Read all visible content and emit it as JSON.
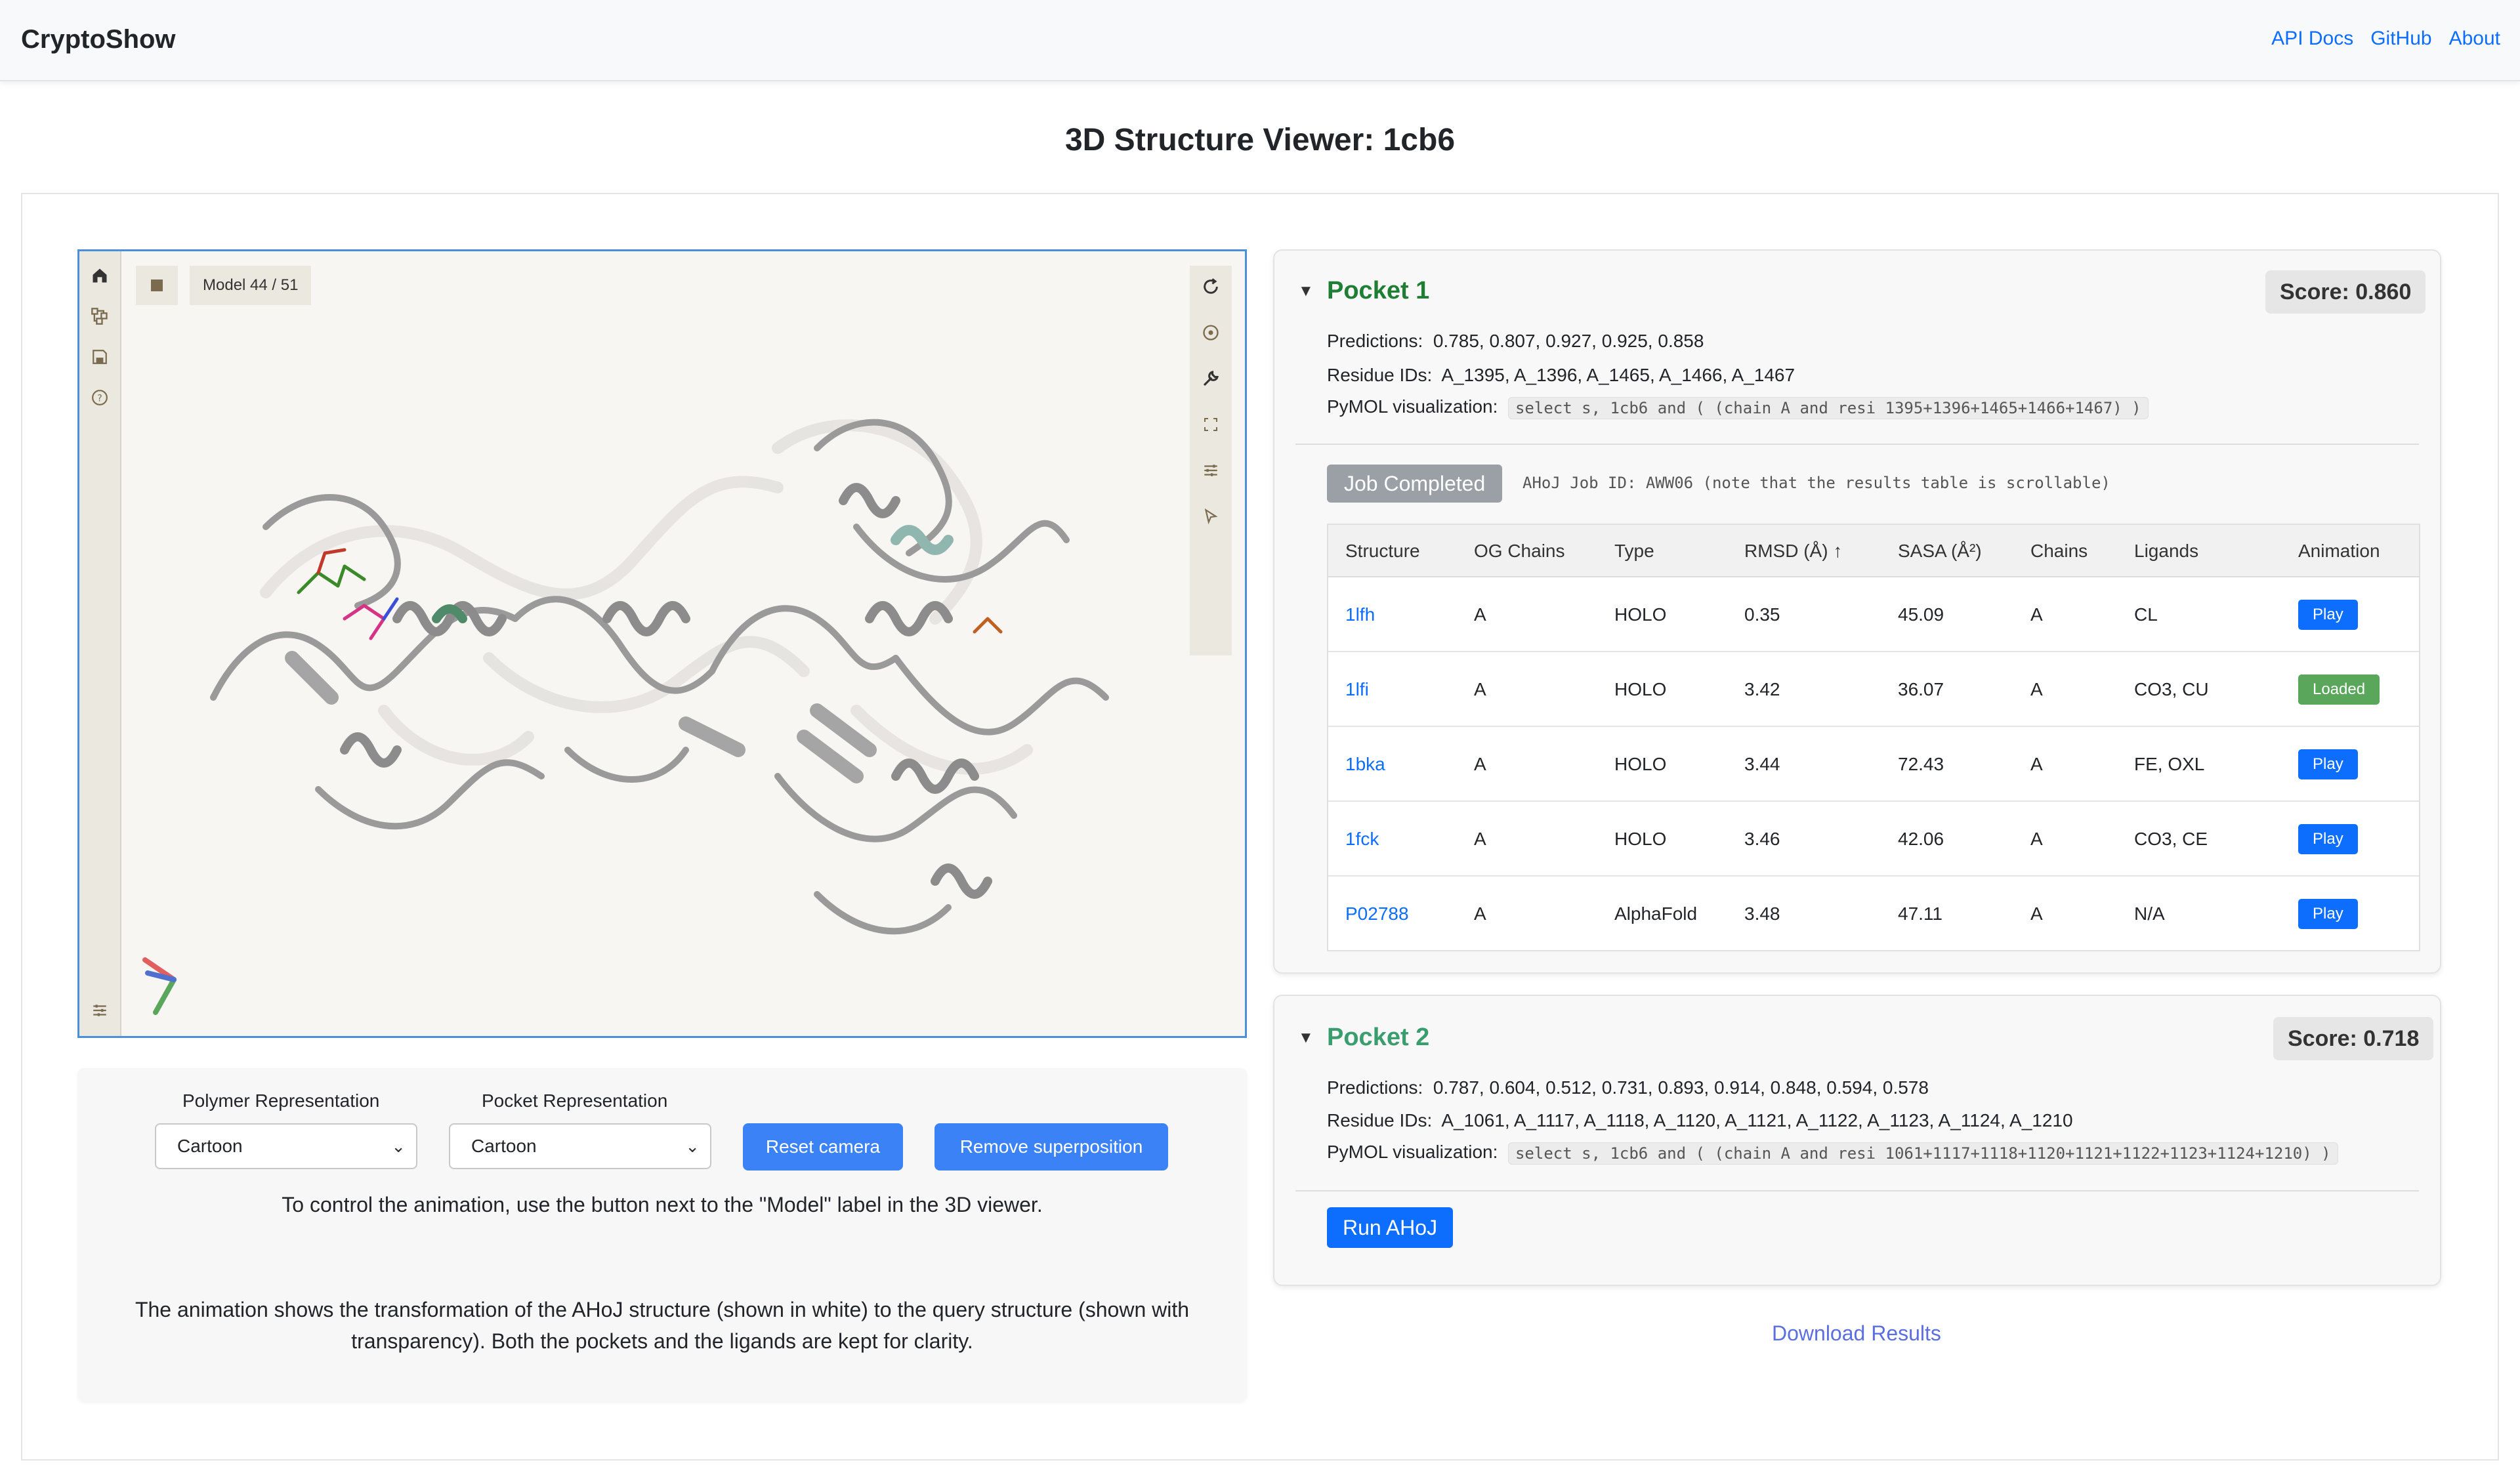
{
  "navbar": {
    "brand": "CryptoShow",
    "links": [
      "API Docs",
      "GitHub",
      "About"
    ]
  },
  "page": {
    "title": "3D Structure Viewer: 1cb6"
  },
  "viewer": {
    "model_label": "Model 44 / 51",
    "left_tools": [
      "home-icon",
      "structure-tree-icon",
      "save-icon",
      "help-icon",
      "settings-icon"
    ],
    "right_tools": [
      "rotate-icon",
      "spin-icon",
      "wrench-icon",
      "fullscreen-icon",
      "sliders-icon",
      "pointer-icon"
    ]
  },
  "controls": {
    "polymer_label": "Polymer Representation",
    "polymer_value": "Cartoon",
    "pocket_label": "Pocket Representation",
    "pocket_value": "Cartoon",
    "reset_camera": "Reset camera",
    "remove_superposition": "Remove superposition",
    "hint": "To control the animation, use the button next to the \"Model\" label in the 3D viewer.",
    "description_line1": "The animation shows the transformation of the AHoJ structure (shown in white) to the query structure (shown with",
    "description_line2": "transparency). Both the pockets and the ligands are kept for clarity."
  },
  "pocket1": {
    "title": "Pocket 1",
    "score": "Score: 0.860",
    "title_color": "#1e7e34",
    "predictions_label": "Predictions:",
    "predictions": "0.785, 0.807, 0.927, 0.925, 0.858",
    "residues_label": "Residue IDs:",
    "residues": "A_1395, A_1396, A_1465, A_1466, A_1467",
    "pymol_label": "PyMOL visualization:",
    "pymol": "select s, 1cb6 and ( (chain A and resi 1395+1396+1465+1466+1467) )",
    "job_status": "Job Completed",
    "job_info": "AHoJ Job ID: AWW06  (note that the results table is scrollable)",
    "table": {
      "headers": [
        "Structure",
        "OG Chains",
        "Type",
        "RMSD (Å) ↑",
        "SASA (Å²)",
        "Chains",
        "Ligands",
        "Animation"
      ],
      "rows": [
        {
          "structure": "1lfh",
          "og": "A",
          "type": "HOLO",
          "rmsd": "0.35",
          "sasa": "45.09",
          "chains": "A",
          "ligands": "CL",
          "anim": "Play"
        },
        {
          "structure": "1lfi",
          "og": "A",
          "type": "HOLO",
          "rmsd": "3.42",
          "sasa": "36.07",
          "chains": "A",
          "ligands": "CO3, CU",
          "anim": "Loaded"
        },
        {
          "structure": "1bka",
          "og": "A",
          "type": "HOLO",
          "rmsd": "3.44",
          "sasa": "72.43",
          "chains": "A",
          "ligands": "FE, OXL",
          "anim": "Play"
        },
        {
          "structure": "1fck",
          "og": "A",
          "type": "HOLO",
          "rmsd": "3.46",
          "sasa": "42.06",
          "chains": "A",
          "ligands": "CO3, CE",
          "anim": "Play"
        },
        {
          "structure": "P02788",
          "og": "A",
          "type": "AlphaFold",
          "rmsd": "3.48",
          "sasa": "47.11",
          "chains": "A",
          "ligands": "N/A",
          "anim": "Play"
        }
      ]
    }
  },
  "pocket2": {
    "title": "Pocket 2",
    "score": "Score: 0.718",
    "title_color": "#3a9d6e",
    "predictions_label": "Predictions:",
    "predictions": "0.787, 0.604, 0.512, 0.731, 0.893, 0.914, 0.848, 0.594, 0.578",
    "residues_label": "Residue IDs:",
    "residues": "A_1061, A_1117, A_1118, A_1120, A_1121, A_1122, A_1123, A_1124, A_1210",
    "pymol_label": "PyMOL visualization:",
    "pymol": "select s, 1cb6 and ( (chain A and resi 1061+1117+1118+1120+1121+1122+1123+1124+1210) )",
    "run_button": "Run AHoJ"
  },
  "download": "Download Results"
}
